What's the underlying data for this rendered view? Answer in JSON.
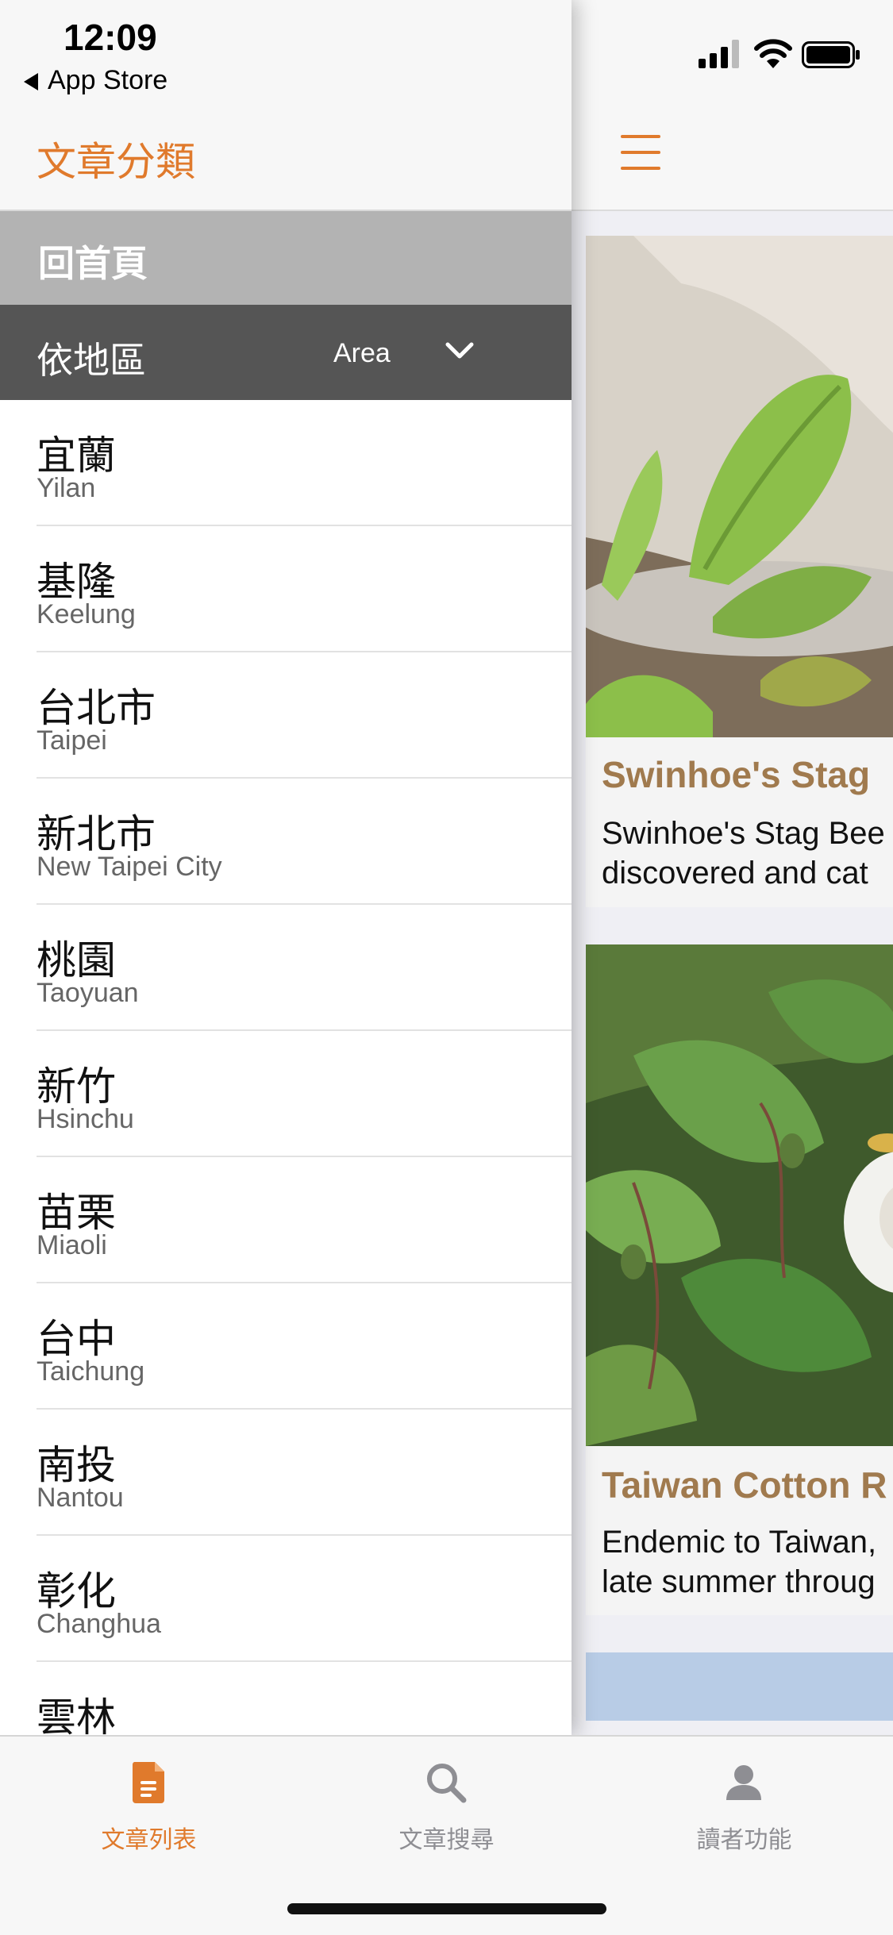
{
  "status_bar": {
    "time": "12:09",
    "back_label": "App Store"
  },
  "drawer": {
    "title": "文章分類",
    "home_label": "回首頁",
    "area": {
      "label_zh": "依地區",
      "label_en": "Area"
    },
    "regions": [
      {
        "zh": "宜蘭",
        "en": "Yilan"
      },
      {
        "zh": "基隆",
        "en": "Keelung"
      },
      {
        "zh": "台北市",
        "en": "Taipei"
      },
      {
        "zh": "新北市",
        "en": "New Taipei City"
      },
      {
        "zh": "桃園",
        "en": "Taoyuan"
      },
      {
        "zh": "新竹",
        "en": "Hsinchu"
      },
      {
        "zh": "苗栗",
        "en": "Miaoli"
      },
      {
        "zh": "台中",
        "en": "Taichung"
      },
      {
        "zh": "南投",
        "en": "Nantou"
      },
      {
        "zh": "彰化",
        "en": "Changhua"
      },
      {
        "zh": "雲林",
        "en": ""
      }
    ]
  },
  "articles": [
    {
      "title": "Swinhoe's Stag",
      "text_line1": "Swinhoe's Stag Bee",
      "text_line2": "discovered and cat"
    },
    {
      "title": "Taiwan Cotton R",
      "text_line1": "Endemic to Taiwan,",
      "text_line2": "late summer throug"
    }
  ],
  "tabbar": {
    "tabs": [
      {
        "label": "文章列表",
        "icon": "document-icon",
        "active": true
      },
      {
        "label": "文章搜尋",
        "icon": "search-icon",
        "active": false
      },
      {
        "label": "讀者功能",
        "icon": "person-icon",
        "active": false
      }
    ]
  },
  "colors": {
    "accent": "#e07a2c",
    "title_brown": "#a07a4e",
    "area_bg": "#555555",
    "home_bg": "#b3b3b3"
  }
}
